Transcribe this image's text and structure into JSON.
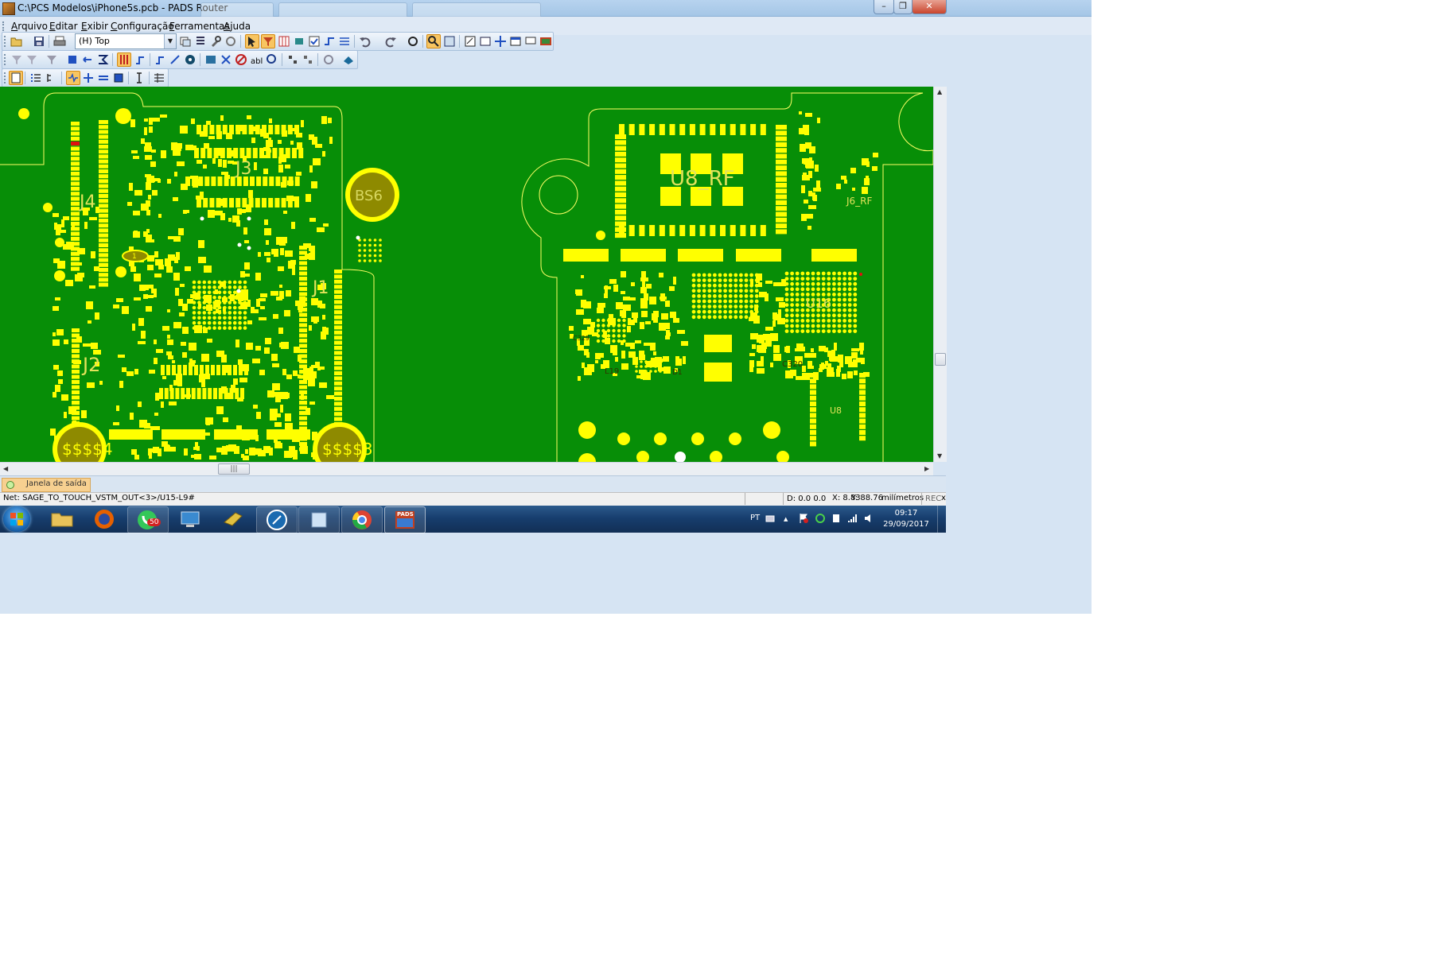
{
  "window": {
    "title": "C:\\PCS Modelos\\iPhone5s.pcb - PADS Router",
    "minimize_glyph": "–",
    "maximize_glyph": "❐",
    "close_glyph": "✕"
  },
  "menu": [
    {
      "accel": "A",
      "rest": "rquivo"
    },
    {
      "accel": "E",
      "rest": "ditar"
    },
    {
      "accel": "E",
      "rest": "xibir"
    },
    {
      "accel": "C",
      "rest": "onfiguração"
    },
    {
      "accel": "F",
      "rest": "erramentas"
    },
    {
      "accel": "A",
      "rest": "juda"
    }
  ],
  "toolbar": {
    "layer_select_value": "(H) Top",
    "layer_arrow": "▼"
  },
  "pcb": {
    "colors": {
      "board": "#078e07",
      "pad": "#ffff00",
      "outline": "#ffff66",
      "hole": "#8e8a00",
      "label": "#e3e35a"
    },
    "labels": [
      "J4",
      "J3",
      "J1",
      "J2",
      "U8_RF",
      "J6_RF",
      "U16",
      "U8",
      "L19",
      "C320",
      "C329",
      "D1",
      "1"
    ],
    "hole_labels": [
      "BS6",
      "$$$$4",
      "$$$$3"
    ]
  },
  "scrollbars": {
    "h_thumb_glyph": "|||"
  },
  "output": {
    "tab_label": "Janela de saída"
  },
  "status": {
    "net": "Net: SAGE_TO_TOUCH_VSTM_OUT<3>/U15-L9#",
    "delta": "D: 0.0 0.0",
    "x": "X: 8.83",
    "y": "Y: 88.76",
    "units": "milímetros",
    "rec": "REC",
    "extra": "x"
  },
  "taskbar": {
    "whatsapp_badge": "50",
    "pads_label": "PADS",
    "lang": "PT",
    "tray_up": "▲",
    "time": "09:17",
    "date": "29/09/2017"
  }
}
